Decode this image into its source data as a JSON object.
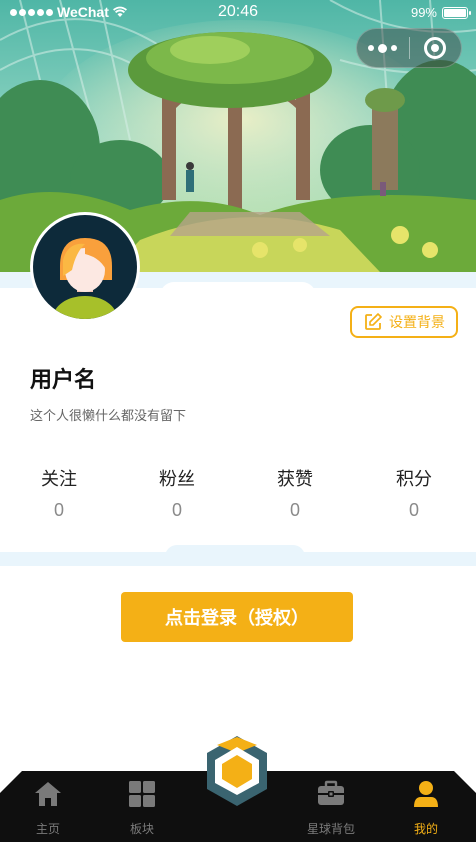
{
  "status_bar": {
    "carrier": "WeChat",
    "time": "20:46",
    "battery": "99%",
    "battery_level": 0.99
  },
  "capsule": {
    "more_icon": "more-dots-icon",
    "close_icon": "mini-program-close-icon"
  },
  "profile": {
    "set_background_label": "设置背景",
    "username": "用户名",
    "bio": "这个人很懒什么都没有留下"
  },
  "stats": [
    {
      "label": "关注",
      "value": "0"
    },
    {
      "label": "粉丝",
      "value": "0"
    },
    {
      "label": "获赞",
      "value": "0"
    },
    {
      "label": "积分",
      "value": "0"
    }
  ],
  "login_button": "点击登录（授权）",
  "tabbar": {
    "items": [
      {
        "label": "主页",
        "icon": "home-icon"
      },
      {
        "label": "板块",
        "icon": "grid-icon"
      },
      {
        "label": "",
        "icon": "center-hexagon-icon"
      },
      {
        "label": "星球背包",
        "icon": "briefcase-icon"
      },
      {
        "label": "我的",
        "icon": "user-icon"
      }
    ],
    "active_index": 4
  },
  "colors": {
    "accent": "#f4b016",
    "band": "#e9f5fc",
    "tabbar_bg": "#0f0f0f",
    "tab_inactive": "#7a7a7a"
  }
}
